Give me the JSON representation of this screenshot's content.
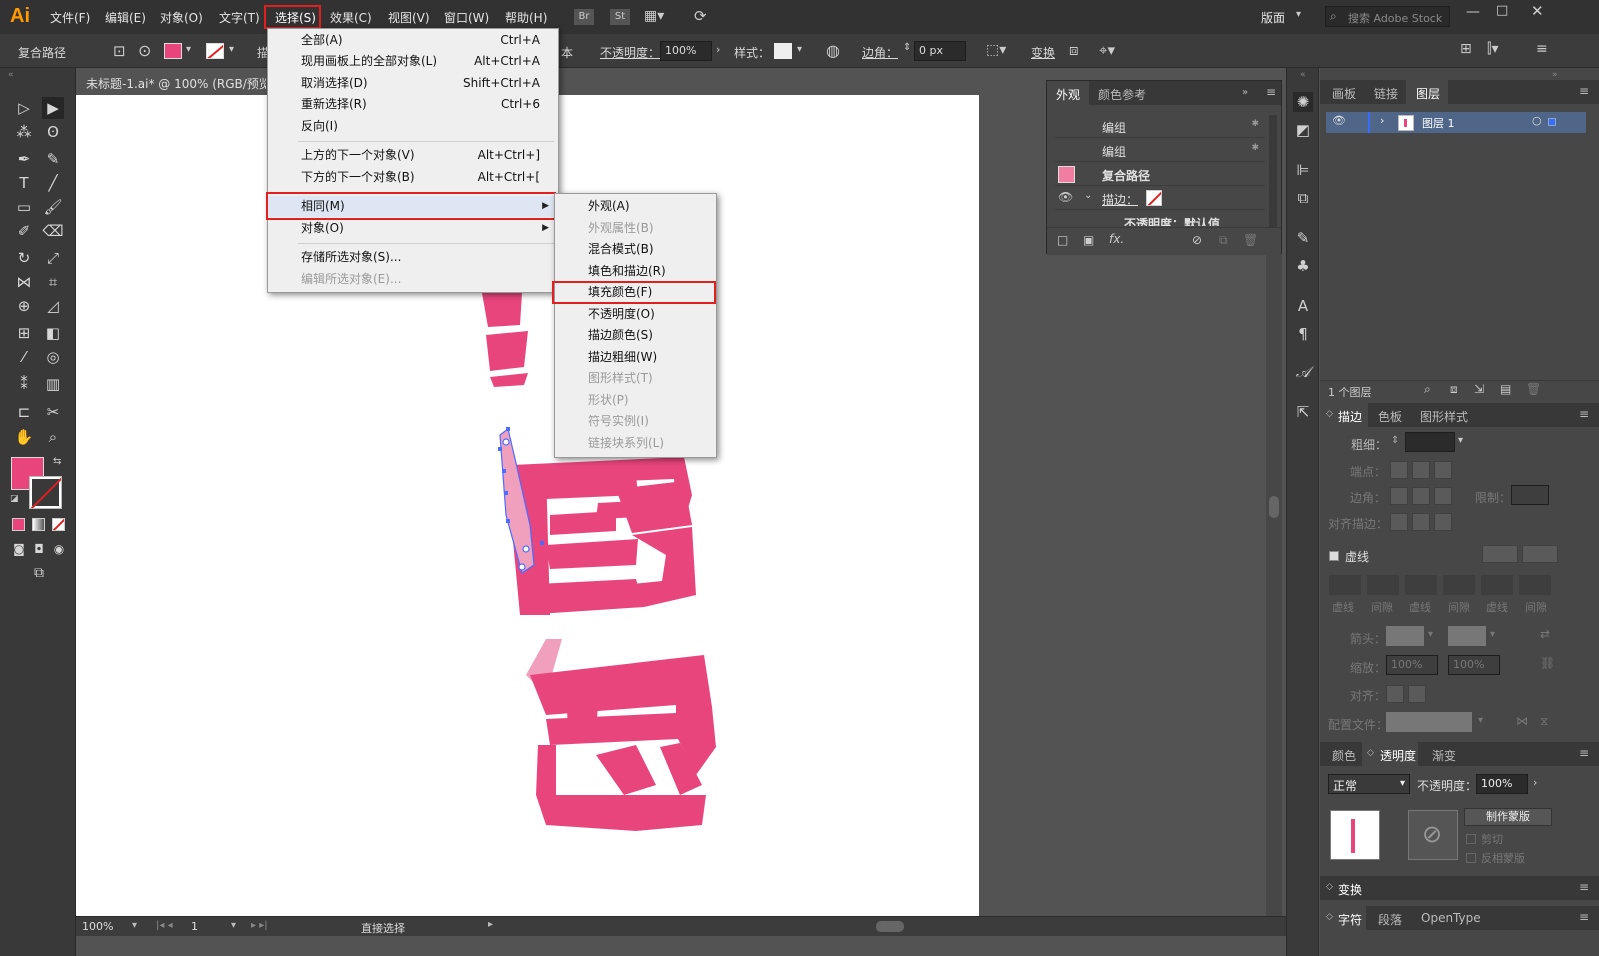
{
  "app": {
    "logo": "Ai"
  },
  "menubar": {
    "items": [
      "文件(F)",
      "编辑(E)",
      "对象(O)",
      "文字(T)",
      "选择(S)",
      "效果(C)",
      "视图(V)",
      "窗口(W)",
      "帮助(H)"
    ],
    "br": "Br",
    "st": "St",
    "workspace": "版面",
    "search_placeholder": "搜索 Adobe Stock"
  },
  "control": {
    "object_type": "复合路径",
    "stroke_label": "描",
    "basic_tail": "本",
    "opacity_label": "不透明度：",
    "opacity_value": "100%",
    "style_label": "样式：",
    "corner_label": "边角：",
    "corner_value": "0 px",
    "transform_label": "变换"
  },
  "document": {
    "tab": "未标题-1.ai* @ 100% (RGB/预览)"
  },
  "select_menu": {
    "items": [
      {
        "label": "全部(A)",
        "shortcut": "Ctrl+A"
      },
      {
        "label": "现用画板上的全部对象(L)",
        "shortcut": "Alt+Ctrl+A"
      },
      {
        "label": "取消选择(D)",
        "shortcut": "Shift+Ctrl+A"
      },
      {
        "label": "重新选择(R)",
        "shortcut": "Ctrl+6"
      },
      {
        "label": "反向(I)",
        "shortcut": ""
      },
      {
        "label": "上方的下一个对象(V)",
        "shortcut": "Alt+Ctrl+]"
      },
      {
        "label": "下方的下一个对象(B)",
        "shortcut": "Alt+Ctrl+["
      },
      {
        "label": "相同(M)",
        "shortcut": ""
      },
      {
        "label": "对象(O)",
        "shortcut": ""
      },
      {
        "label": "存储所选对象(S)...",
        "shortcut": ""
      },
      {
        "label": "编辑所选对象(E)...",
        "shortcut": ""
      }
    ]
  },
  "same_submenu": {
    "items": [
      "外观(A)",
      "外观属性(B)",
      "混合模式(B)",
      "填色和描边(R)",
      "填充颜色(F)",
      "不透明度(O)",
      "描边颜色(S)",
      "描边粗细(W)",
      "图形样式(T)",
      "形状(P)",
      "符号实例(I)",
      "链接块系列(L)"
    ]
  },
  "appearance_panel": {
    "tabs": [
      "外观",
      "颜色参考"
    ],
    "rows": [
      "编组",
      "编组",
      "复合路径",
      "描边：",
      "不透明度：默认值"
    ]
  },
  "layers_panel": {
    "tabs": [
      "画板",
      "链接",
      "图层"
    ],
    "layer_name": "图层 1",
    "footer": "1 个图层"
  },
  "stroke_panel": {
    "tabs": [
      "描边",
      "色板",
      "图形样式"
    ],
    "weight_label": "粗细：",
    "cap_label": "端点：",
    "corner_label": "边角：",
    "limit_label": "限制：",
    "align_label": "对齐描边：",
    "dashed_label": "虚线",
    "dash_labels": [
      "虚线",
      "间隙",
      "虚线",
      "间隙",
      "虚线",
      "间隙"
    ],
    "arrow_label": "箭头：",
    "scale_label": "缩放：",
    "scale_values": [
      "100%",
      "100%"
    ],
    "align2_label": "对齐：",
    "profile_label": "配置文件："
  },
  "transparency_panel": {
    "tabs": [
      "颜色",
      "透明度",
      "渐变"
    ],
    "blend_mode": "正常",
    "opacity_label": "不透明度：",
    "opacity_value": "100%",
    "make_mask": "制作蒙版",
    "clip": "剪切",
    "invert": "反相蒙版"
  },
  "bottom_panels": {
    "transform": "变换",
    "char_tabs": [
      "字符",
      "段落",
      "OpenType"
    ]
  },
  "status": {
    "zoom": "100%",
    "artboard": "1",
    "tool": "直接选择"
  },
  "colors": {
    "accent": "#e8457d",
    "highlight": "#e02020"
  }
}
